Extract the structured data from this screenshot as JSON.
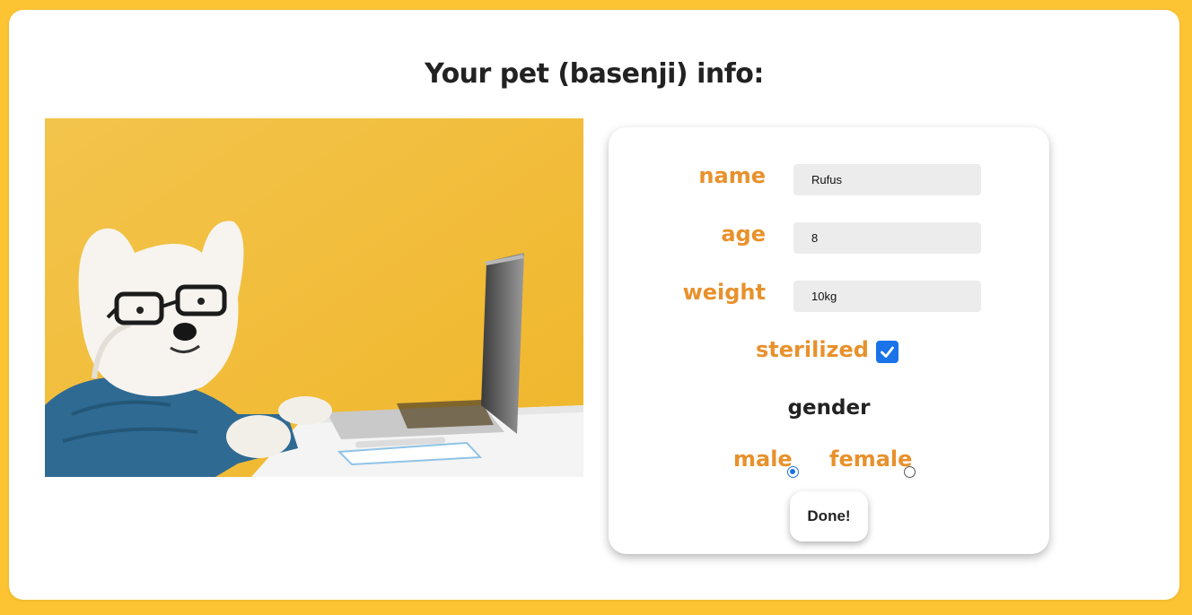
{
  "page": {
    "title": "Your pet (basenji) info:",
    "background_color": "#fcc332",
    "accent_color": "#e8912c"
  },
  "photo": {
    "icon": "dog-with-laptop-photo"
  },
  "form": {
    "fields": [
      {
        "label": "name",
        "value": "Rufus"
      },
      {
        "label": "age",
        "value": "8"
      },
      {
        "label": "weight",
        "value": "10kg"
      }
    ],
    "sterilized": {
      "label": "sterilized",
      "checked": true
    },
    "gender": {
      "heading": "gender",
      "options": [
        {
          "label": "male",
          "checked": true
        },
        {
          "label": "female",
          "checked": false
        }
      ]
    },
    "submit_label": "Done!"
  }
}
